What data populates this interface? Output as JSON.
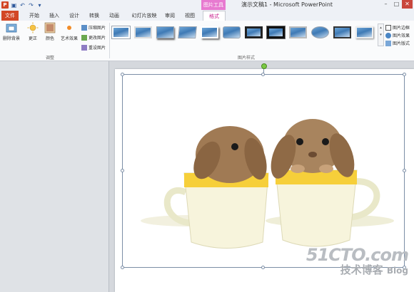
{
  "window": {
    "title": "演示文稿1 - Microsoft PowerPoint",
    "context_tab_title": "图片工具"
  },
  "qat": {
    "logo": "P",
    "save_icon": "save-icon",
    "undo_icon": "undo-icon",
    "redo_icon": "redo-icon",
    "customize_icon": "dropdown-icon"
  },
  "tabs": [
    {
      "label": "文件"
    },
    {
      "label": "开始"
    },
    {
      "label": "插入"
    },
    {
      "label": "设计"
    },
    {
      "label": "转换"
    },
    {
      "label": "动画"
    },
    {
      "label": "幻灯片放映"
    },
    {
      "label": "审阅"
    },
    {
      "label": "视图"
    },
    {
      "label": "格式"
    }
  ],
  "ribbon": {
    "remove_bg": "删除背景",
    "corrections": "更正",
    "color": "颜色",
    "artistic": "艺术效果",
    "compress": "压缩图片",
    "change": "更改图片",
    "reset": "重设图片",
    "group_adjust": "调整",
    "group_styles": "图片样式",
    "border": "图片边框",
    "effects": "图片效果",
    "layout": "图片版式"
  },
  "watermark": {
    "top": "51CTO.com",
    "bottom_cn": "技术博客",
    "bottom_en": "Blog"
  },
  "colors": {
    "accent_file": "#d24726",
    "context": "#e77ad0",
    "format_tab": "#c8208d"
  }
}
